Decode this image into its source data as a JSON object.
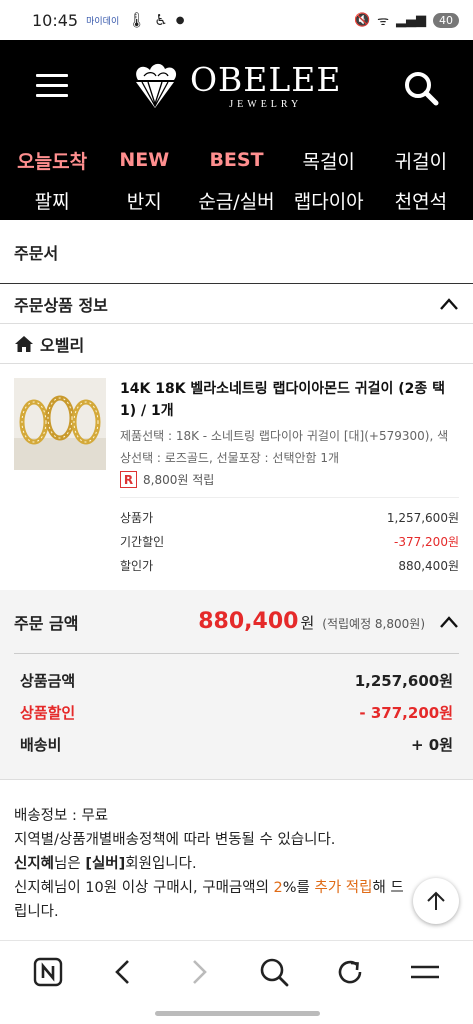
{
  "status_bar": {
    "time": "10:45",
    "mini_label": "마이데이",
    "battery": "40"
  },
  "header": {
    "brand": "OBELEE",
    "brand_sub": "JEWELRY",
    "nav_row1": [
      "오늘도착",
      "NEW",
      "BEST",
      "목걸이",
      "귀걸이"
    ],
    "nav_row2": [
      "팔찌",
      "반지",
      "순금/실버",
      "랩다이아",
      "천연석"
    ]
  },
  "page_title": "주문서",
  "goods_section_title": "주문상품 정보",
  "store_name": "오벨리",
  "product": {
    "name": "14K 18K 벨라소네트링 랩다이아몬드 귀걸이 (2종 택1) / 1개",
    "options": "제품선택 : 18K - 소네트링 랩다이아 귀걸이 [대](+579300), 색상선택 : 로즈골드, 선물포장 : 선택안함 1개",
    "point_badge": "R",
    "points": "8,800원 적립",
    "price_rows": [
      {
        "label": "상품가",
        "value": "1,257,600원"
      },
      {
        "label": "기간할인",
        "value": "-377,200원"
      },
      {
        "label": "할인가",
        "value": "880,400원"
      }
    ]
  },
  "order_total": {
    "label": "주문 금액",
    "amount": "880,400",
    "won": "원",
    "point_note": "(적립예정 8,800원)",
    "rows": [
      {
        "label": "상품금액",
        "value": "1,257,600원"
      },
      {
        "label": "상품할인",
        "value": "- 377,200원"
      },
      {
        "label": "배송비",
        "value": "+ 0원"
      }
    ]
  },
  "delivery": {
    "line1": "배송정보 : 무료",
    "line2": "지역별/상품개별배송정책에 따라 변동될 수 있습니다.",
    "member_name": "신지혜",
    "member_mid": "님은 ",
    "member_grade": "[실버]",
    "member_end": "회원입니다.",
    "benefit_a": "신지혜님이 10원 이상 구매시, 구매금액의 ",
    "benefit_pct": "2",
    "benefit_b": "%를 ",
    "benefit_c": "추가 적립",
    "benefit_d": "해 드",
    "benefit_tail": "립니다."
  },
  "colors": {
    "header_bg": "#000000",
    "nav_highlight": "#ff8f8f",
    "price_red": "#e52a2a",
    "accent_orange": "#e06b16"
  }
}
